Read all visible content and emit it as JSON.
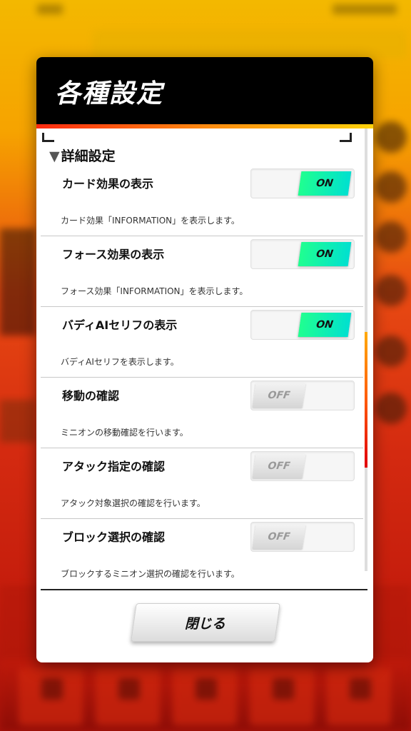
{
  "dialog": {
    "title": "各種設定",
    "section_marker": "▼",
    "section_title": "詳細設定",
    "close_label": "閉じる"
  },
  "settings": [
    {
      "label": "カード効果の表示",
      "description": "カード効果「INFORMATION」を表示します。",
      "state": "ON",
      "enabled": true
    },
    {
      "label": "フォース効果の表示",
      "description": "フォース効果「INFORMATION」を表示します。",
      "state": "ON",
      "enabled": true
    },
    {
      "label": "バディAIセリフの表示",
      "description": "バディAIセリフを表示します。",
      "state": "ON",
      "enabled": true
    },
    {
      "label": "移動の確認",
      "description": "ミニオンの移動確認を行います。",
      "state": "OFF",
      "enabled": false
    },
    {
      "label": "アタック指定の確認",
      "description": "アタック対象選択の確認を行います。",
      "state": "OFF",
      "enabled": false
    },
    {
      "label": "ブロック選択の確認",
      "description": "ブロックするミニオン選択の確認を行います。",
      "state": "OFF",
      "enabled": false
    }
  ],
  "colors": {
    "on_toggle": "#20ff90",
    "header_bg": "#000000",
    "accent_stripe": "#ff5a10"
  }
}
